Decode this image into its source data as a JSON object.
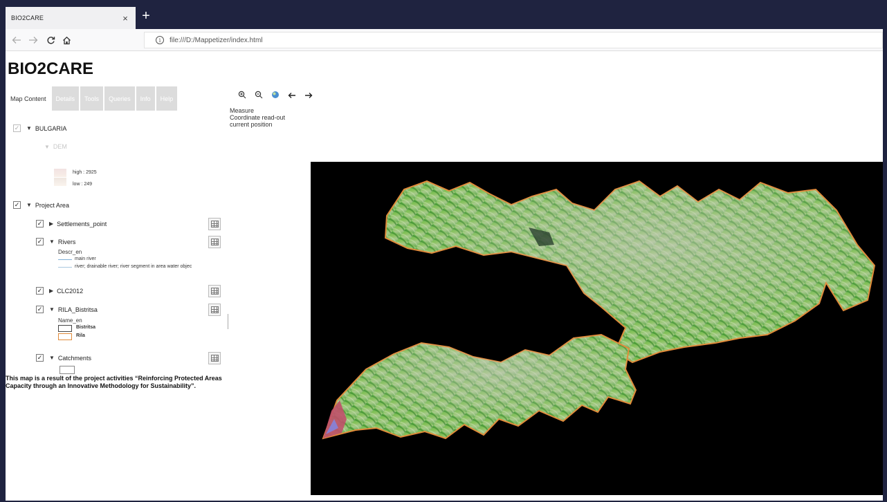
{
  "browser": {
    "tab_title": "BIO2CARE",
    "tab_close": "×",
    "new_tab": "+",
    "url": "file:///D:/Mappetizer/index.html",
    "info_glyph": "i"
  },
  "app": {
    "title": "BIO2CARE"
  },
  "tabs": [
    {
      "label": "Map Content",
      "active": true
    },
    {
      "label": "Details",
      "active": false
    },
    {
      "label": "Tools",
      "active": false
    },
    {
      "label": "Queries",
      "active": false
    },
    {
      "label": "Info",
      "active": false
    },
    {
      "label": "Help",
      "active": false
    }
  ],
  "layers": {
    "bulgaria": {
      "label": "BULGARIA",
      "checked": true
    },
    "dem": {
      "label": "DEM",
      "legend_high": "high : 2925",
      "legend_low": "low : 249"
    },
    "project_area": {
      "label": "Project Area",
      "checked": true
    },
    "settlements": {
      "label": "Settlements_point",
      "checked": true
    },
    "rivers": {
      "label": "Rivers",
      "checked": true,
      "legend_title": "Descr_en",
      "legend_items": [
        "main river",
        "river; drainable river; river segment in area water objec"
      ]
    },
    "clc2012": {
      "label": "CLC2012",
      "checked": true
    },
    "rila_bistritsa": {
      "label": "RILA_Bistritsa",
      "checked": true,
      "legend_title": "Name_en",
      "legend_items": [
        "Bistritsa",
        "Rila"
      ]
    },
    "catchments": {
      "label": "Catchments",
      "checked": true
    }
  },
  "footer_note": "This map is a result of the project activities “Reinforcing Protected Areas Capacity through an Innovative Methodology for Sustainability”.",
  "map_tools": {
    "measure": "Measure",
    "coordinate": "Coordinate read-out",
    "position": "current position"
  },
  "colors": {
    "chrome": "#1f2340",
    "rila_outline": "#e08a3a",
    "bistritsa_outline": "#444444",
    "river_main": "#7fb0d8",
    "river_other": "#a9c8e0"
  }
}
